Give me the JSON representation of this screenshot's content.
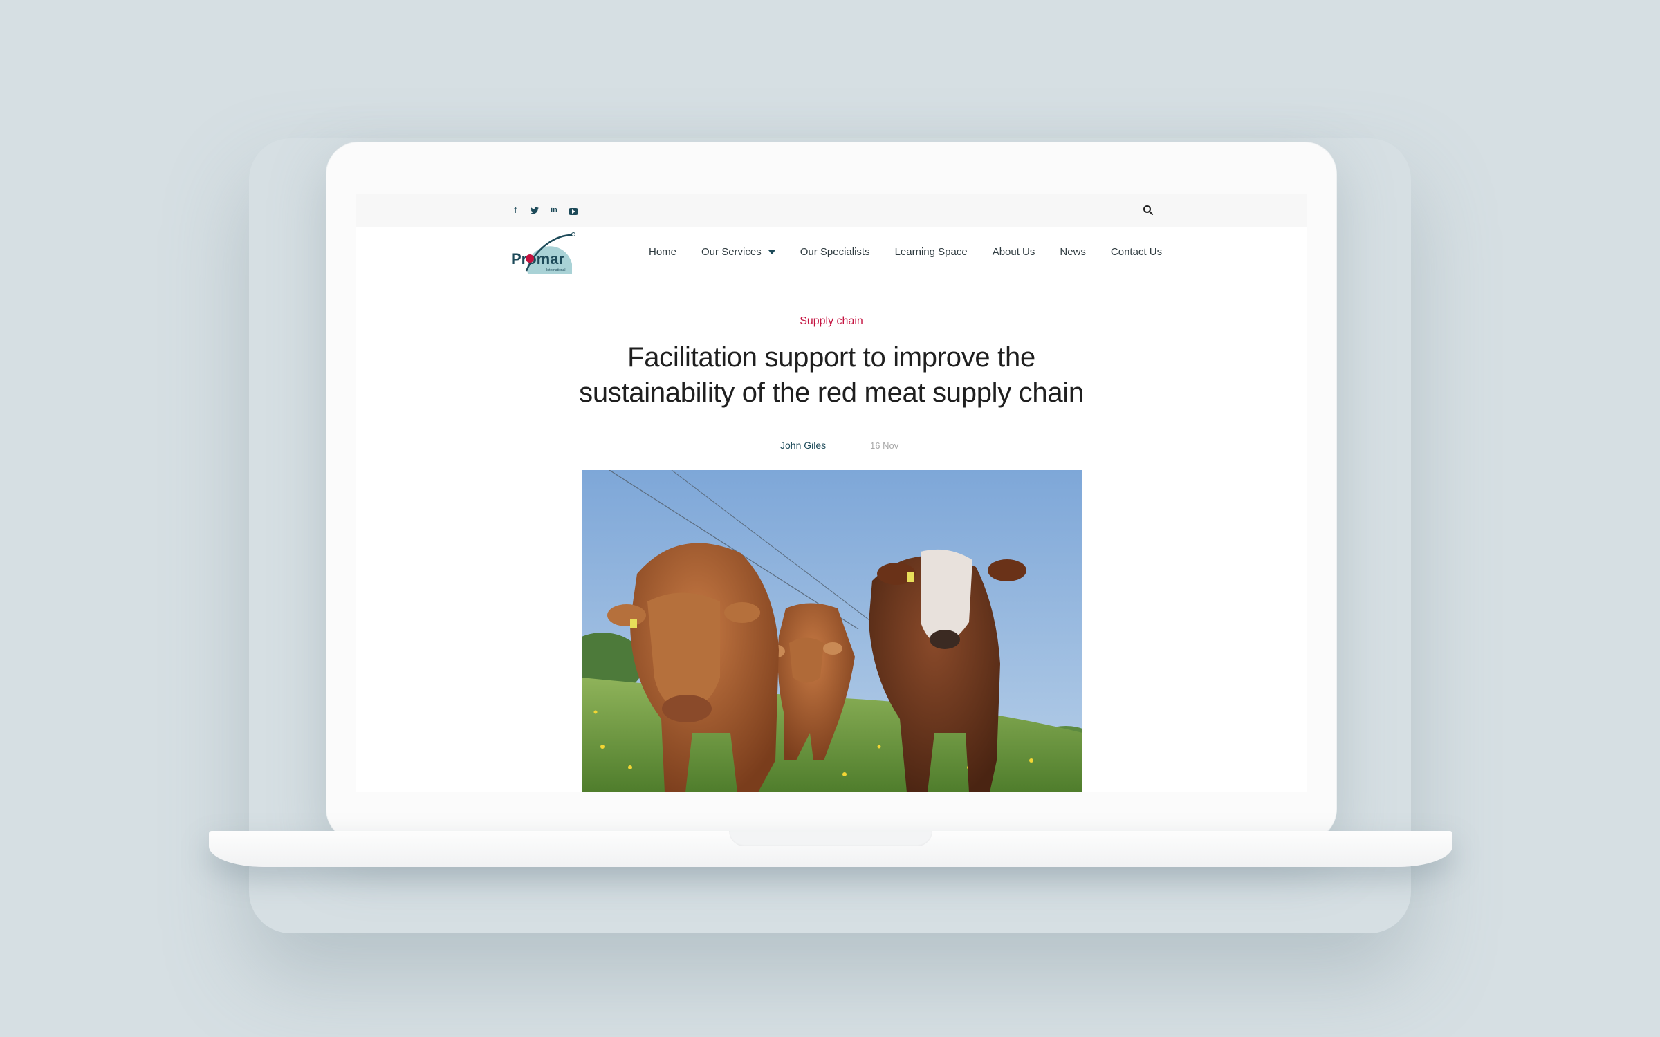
{
  "colors": {
    "background": "#d6dfe3",
    "brand_teal": "#1d4a59",
    "category_red": "#c4123f",
    "logo_red": "#c4123f"
  },
  "social": [
    {
      "icon": "facebook-icon",
      "glyph": "f"
    },
    {
      "icon": "twitter-icon",
      "glyph": "🐦"
    },
    {
      "icon": "linkedin-icon",
      "glyph": "in"
    },
    {
      "icon": "youtube-icon",
      "glyph": ""
    }
  ],
  "header": {
    "logo_text": "Promar",
    "logo_subtext": "International",
    "search_icon": "search-icon"
  },
  "nav": {
    "items": [
      {
        "label": "Home"
      },
      {
        "label": "Our Services",
        "has_dropdown": true
      },
      {
        "label": "Our Specialists"
      },
      {
        "label": "Learning Space"
      },
      {
        "label": "About Us"
      },
      {
        "label": "News"
      },
      {
        "label": "Contact Us"
      }
    ]
  },
  "article": {
    "category": "Supply chain",
    "title": "Facilitation support to improve the sustainability of the red meat supply chain",
    "author": "John Giles",
    "date": "16 Nov",
    "image_subject": "three-cattle-in-field"
  }
}
